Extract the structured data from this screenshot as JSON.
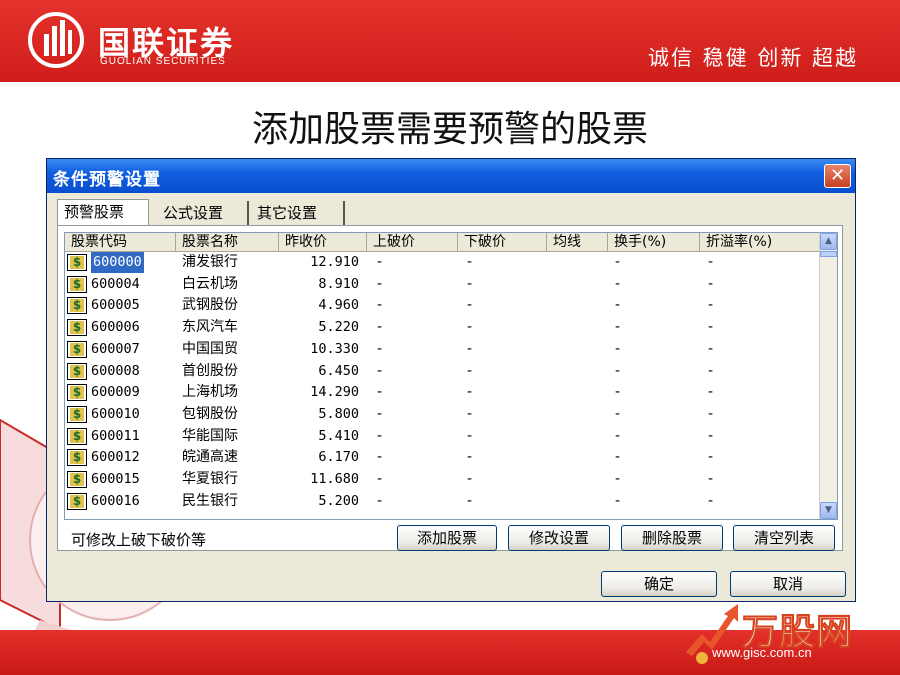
{
  "slide": {
    "logo_cn": "国联证券",
    "logo_en": "GUOLIAN SECURITIES",
    "slogan": "诚信 稳健 创新 超越",
    "title": "添加股票需要预警的股票",
    "watermark_cn": "万股网",
    "watermark_url": "www.gisc.com.cn"
  },
  "dialog": {
    "title": "条件预警设置",
    "close_glyph": "✕",
    "tabs": [
      {
        "label": "预警股票",
        "active": true
      },
      {
        "label": "公式设置",
        "active": false
      },
      {
        "label": "其它设置",
        "active": false
      }
    ],
    "columns": [
      "股票代码",
      "股票名称",
      "昨收价",
      "上破价",
      "下破价",
      "均线",
      "换手(%)",
      "折溢率(%)"
    ],
    "rows": [
      {
        "code": "600000",
        "name": "浦发银行",
        "prev_close": "12.910",
        "up": "-",
        "down": "-",
        "ma": "",
        "turnover": "-",
        "premium": "-",
        "selected": true
      },
      {
        "code": "600004",
        "name": "白云机场",
        "prev_close": "8.910",
        "up": "-",
        "down": "-",
        "ma": "",
        "turnover": "-",
        "premium": "-"
      },
      {
        "code": "600005",
        "name": "武钢股份",
        "prev_close": "4.960",
        "up": "-",
        "down": "-",
        "ma": "",
        "turnover": "-",
        "premium": "-"
      },
      {
        "code": "600006",
        "name": "东风汽车",
        "prev_close": "5.220",
        "up": "-",
        "down": "-",
        "ma": "",
        "turnover": "-",
        "premium": "-"
      },
      {
        "code": "600007",
        "name": "中国国贸",
        "prev_close": "10.330",
        "up": "-",
        "down": "-",
        "ma": "",
        "turnover": "-",
        "premium": "-"
      },
      {
        "code": "600008",
        "name": "首创股份",
        "prev_close": "6.450",
        "up": "-",
        "down": "-",
        "ma": "",
        "turnover": "-",
        "premium": "-"
      },
      {
        "code": "600009",
        "name": "上海机场",
        "prev_close": "14.290",
        "up": "-",
        "down": "-",
        "ma": "",
        "turnover": "-",
        "premium": "-"
      },
      {
        "code": "600010",
        "name": "包钢股份",
        "prev_close": "5.800",
        "up": "-",
        "down": "-",
        "ma": "",
        "turnover": "-",
        "premium": "-"
      },
      {
        "code": "600011",
        "name": "华能国际",
        "prev_close": "5.410",
        "up": "-",
        "down": "-",
        "ma": "",
        "turnover": "-",
        "premium": "-"
      },
      {
        "code": "600012",
        "name": "皖通高速",
        "prev_close": "6.170",
        "up": "-",
        "down": "-",
        "ma": "",
        "turnover": "-",
        "premium": "-"
      },
      {
        "code": "600015",
        "name": "华夏银行",
        "prev_close": "11.680",
        "up": "-",
        "down": "-",
        "ma": "",
        "turnover": "-",
        "premium": "-"
      },
      {
        "code": "600016",
        "name": "民生银行",
        "prev_close": "5.200",
        "up": "-",
        "down": "-",
        "ma": "",
        "turnover": "-",
        "premium": "-"
      }
    ],
    "row_icon_glyph": "$",
    "hint": "可修改上破下破价等",
    "buttons": {
      "add": "添加股票",
      "modify": "修改设置",
      "delete": "删除股票",
      "clear": "清空列表",
      "ok": "确定",
      "cancel": "取消"
    },
    "scroll_up_glyph": "▲",
    "scroll_down_glyph": "▼"
  },
  "colors": {
    "brand_red": "#d92620",
    "titlebar_blue": "#0a4ed0",
    "selection_blue": "#316ac5"
  }
}
